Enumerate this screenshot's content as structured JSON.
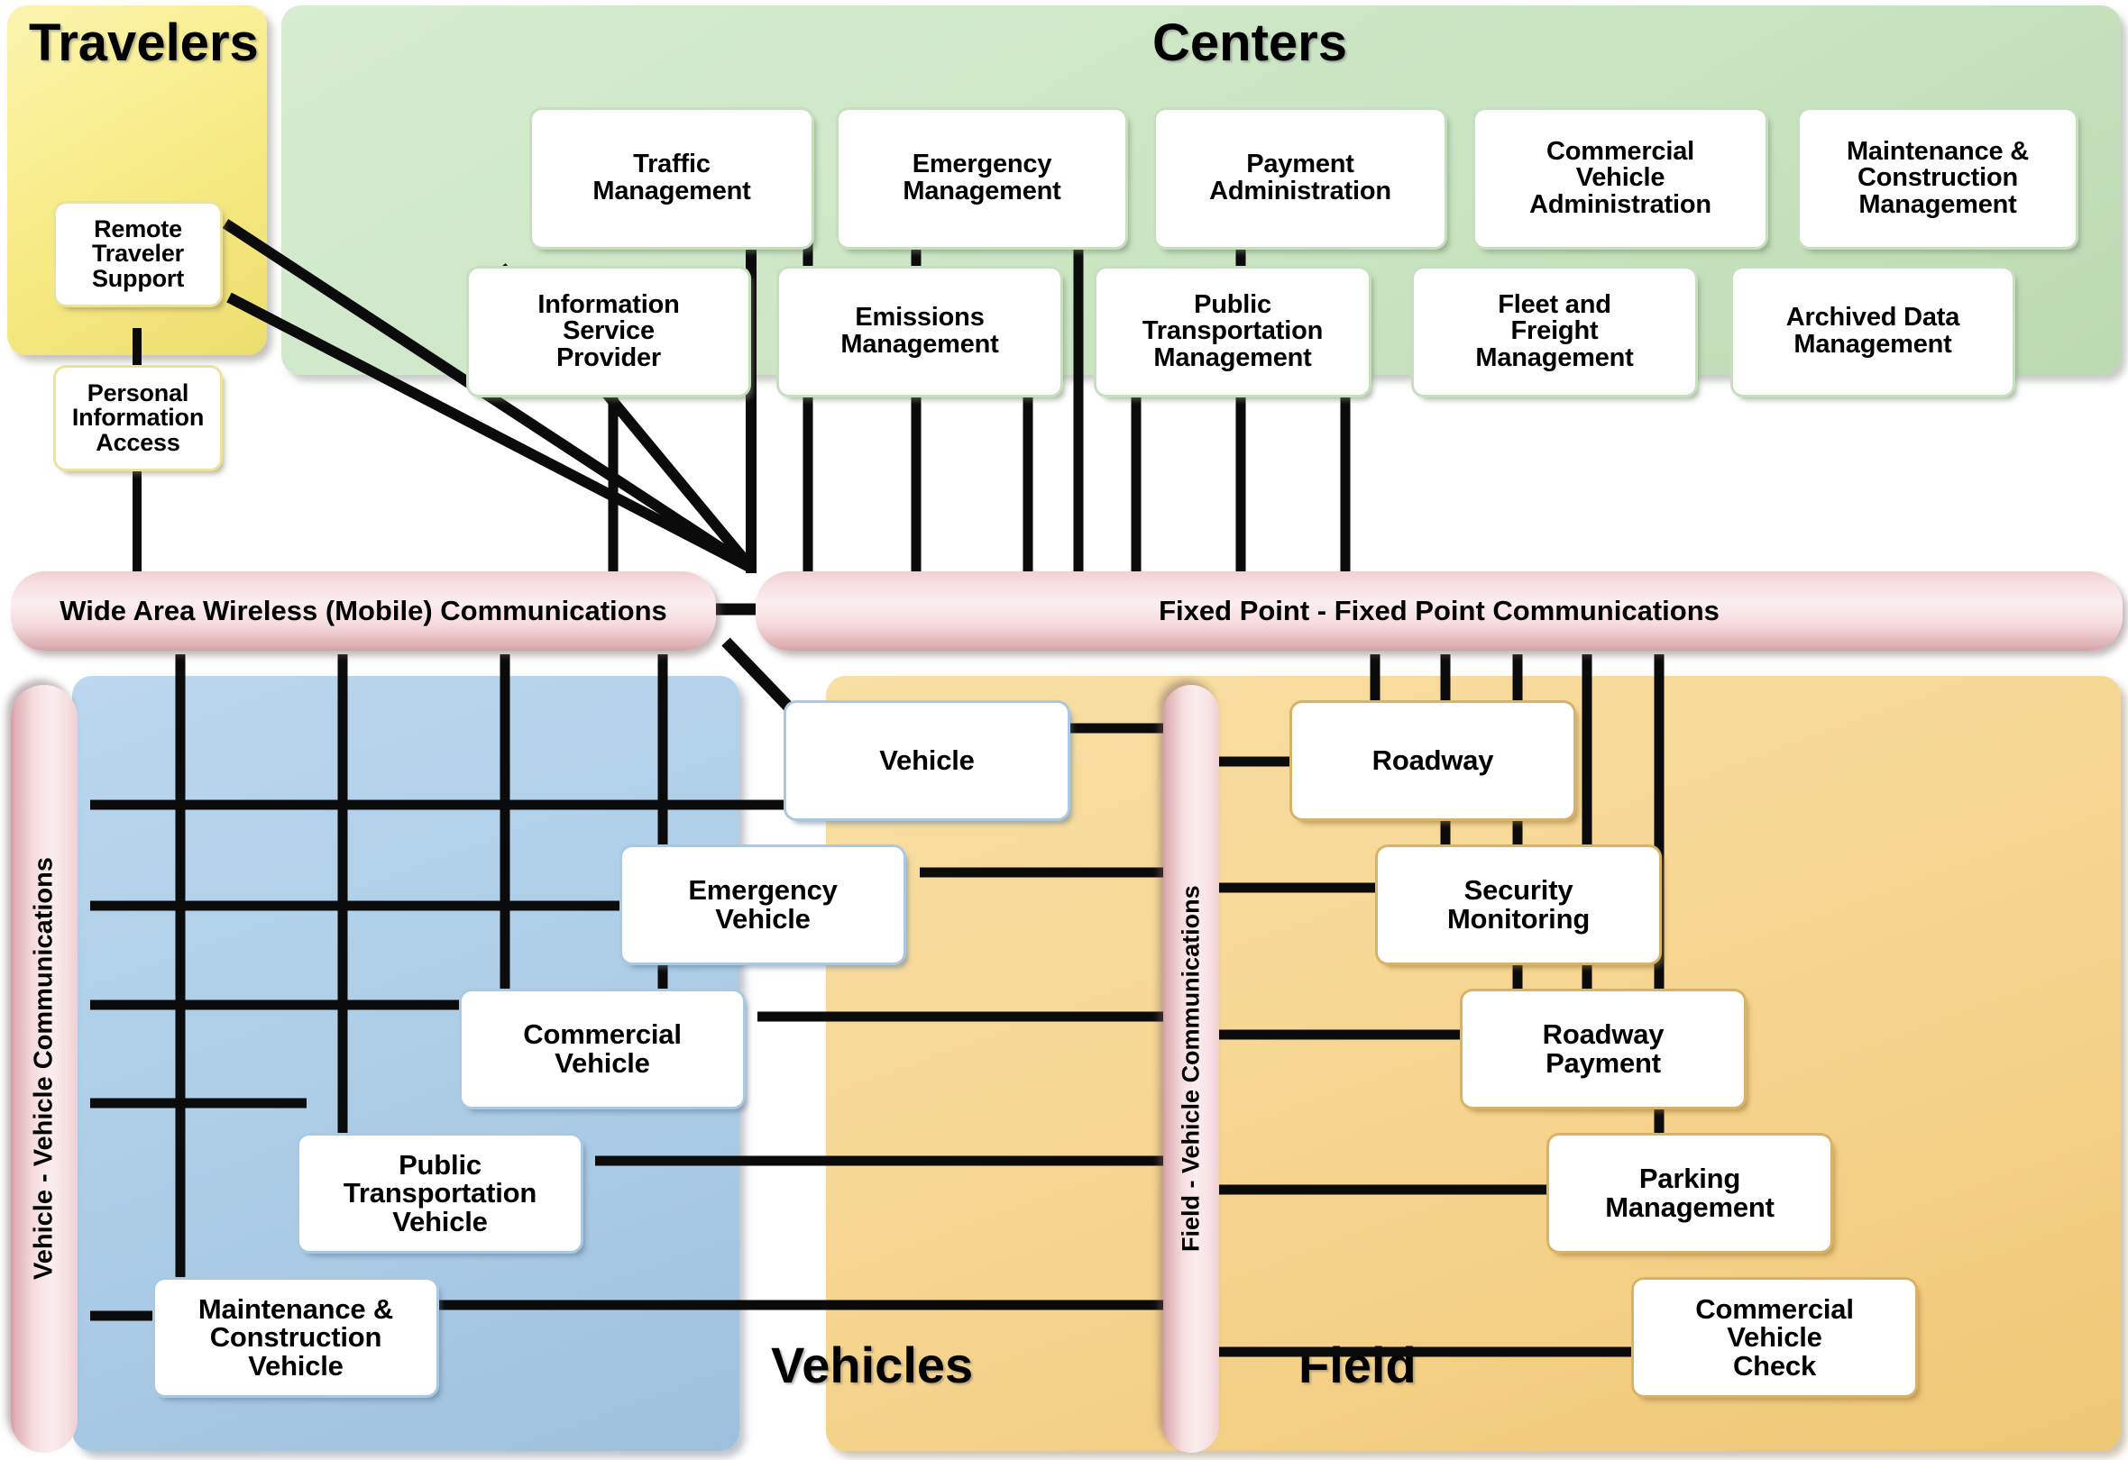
{
  "diagram": {
    "title_panels": {
      "travelers": "Travelers",
      "centers": "Centers",
      "vehicles": "Vehicles",
      "field": "Field"
    },
    "colors": {
      "travelers_panel": "#f7ec8c",
      "centers_panel": "#cde6c5",
      "vehicles_panel": "#b0cfe8",
      "field_panel": "#f5d58e",
      "comm_bar": "#f7dfe1",
      "entity_box": "#ffffff",
      "line": "#0b0b0b"
    }
  },
  "travelers": {
    "label": "Travelers",
    "entities": [
      {
        "id": "remote-traveler-support",
        "label": "Remote\nTraveler\nSupport"
      },
      {
        "id": "personal-information-access",
        "label": "Personal\nInformation\nAccess"
      }
    ]
  },
  "centers": {
    "label": "Centers",
    "row_top": [
      {
        "id": "traffic-management",
        "label": "Traffic\nManagement"
      },
      {
        "id": "emergency-management",
        "label": "Emergency\nManagement"
      },
      {
        "id": "payment-administration",
        "label": "Payment\nAdministration"
      },
      {
        "id": "commercial-vehicle-administration",
        "label": "Commercial\nVehicle\nAdministration"
      },
      {
        "id": "maintenance-construction-management",
        "label": "Maintenance &\nConstruction\nManagement"
      }
    ],
    "row_bottom": [
      {
        "id": "information-service-provider",
        "label": "Information\nService\nProvider"
      },
      {
        "id": "emissions-management",
        "label": "Emissions\nManagement"
      },
      {
        "id": "public-transportation-management",
        "label": "Public\nTransportation\nManagement"
      },
      {
        "id": "fleet-and-freight-management",
        "label": "Fleet and\nFreight\nManagement"
      },
      {
        "id": "archived-data-management",
        "label": "Archived Data\nManagement"
      }
    ]
  },
  "communications": {
    "wide_area_wireless": "Wide Area Wireless (Mobile) Communications",
    "fixed_point": "Fixed Point - Fixed Point Communications",
    "vehicle_vehicle": "Vehicle - Vehicle Communications",
    "field_vehicle": "Field - Vehicle Communications"
  },
  "vehicles": {
    "label": "Vehicles",
    "entities": [
      {
        "id": "vehicle",
        "label": "Vehicle"
      },
      {
        "id": "emergency-vehicle",
        "label": "Emergency\nVehicle"
      },
      {
        "id": "commercial-vehicle",
        "label": "Commercial\nVehicle"
      },
      {
        "id": "public-transportation-vehicle",
        "label": "Public\nTransportation\nVehicle"
      },
      {
        "id": "maintenance-construction-vehicle",
        "label": "Maintenance &\nConstruction\nVehicle"
      }
    ]
  },
  "field": {
    "label": "Field",
    "entities": [
      {
        "id": "roadway",
        "label": "Roadway"
      },
      {
        "id": "security-monitoring",
        "label": "Security\nMonitoring"
      },
      {
        "id": "roadway-payment",
        "label": "Roadway\nPayment"
      },
      {
        "id": "parking-management",
        "label": "Parking\nManagement"
      },
      {
        "id": "commercial-vehicle-check",
        "label": "Commercial\nVehicle\nCheck"
      }
    ]
  }
}
